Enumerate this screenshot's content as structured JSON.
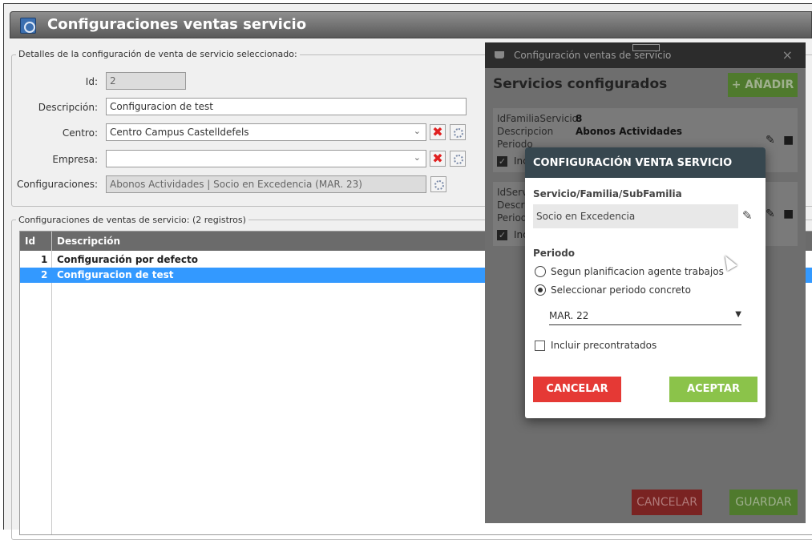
{
  "window": {
    "title": "Configuraciones ventas servicio"
  },
  "details": {
    "legend": "Detalles de la configuración de venta de servicio seleccionado:",
    "id_label": "Id:",
    "id_value": "2",
    "descripcion_label": "Descripción:",
    "descripcion_value": "Configuracion de test",
    "centro_label": "Centro:",
    "centro_value": "Centro Campus Castelldefels",
    "empresa_label": "Empresa:",
    "empresa_value": "",
    "configuraciones_label": "Configuraciones:",
    "configuraciones_value": "Abonos Actividades | Socio en Excedencia (MAR. 23)",
    "clear_glyph": "✖"
  },
  "list": {
    "legend": "Configuraciones de ventas de servicio: (2 registros)",
    "columns": [
      "Id",
      "Descripción"
    ],
    "rows": [
      {
        "id": "1",
        "descripcion": "Configuración por defecto",
        "selected": false
      },
      {
        "id": "2",
        "descripcion": "Configuracion de test",
        "selected": true
      }
    ]
  },
  "panel": {
    "title": "Configuración ventas de servicio",
    "close": "×",
    "heading": "Servicios configurados",
    "add_label": "+ AÑADIR",
    "card1": {
      "k1": "IdFamiliaServicio",
      "v1": "8",
      "k2": "Descripcion",
      "v2": "Abonos Actividades",
      "k3": "Periodo",
      "include": "Inc"
    },
    "card2": {
      "k1": "IdServi",
      "k2": "Descrip",
      "k3": "Period",
      "include": "Inc"
    },
    "cancel_label": "CANCELAR",
    "save_label": "GUARDAR"
  },
  "dialog": {
    "title": "CONFIGURACIÓN VENTA SERVICIO",
    "service_section": "Servicio/Familia/SubFamilia",
    "service_value": "Socio en Excedencia",
    "periodo_section": "Periodo",
    "option1": "Segun planificacion agente trabajos",
    "option2": "Seleccionar periodo concreto",
    "selected_option": 2,
    "period_value": "MAR. 22",
    "include_label": "Incluir precontratados",
    "include_checked": false,
    "cancel_label": "CANCELAR",
    "accept_label": "ACEPTAR"
  },
  "colors": {
    "selection": "#3399ff",
    "danger": "#e53935",
    "success": "#8bc34a",
    "dialog_header": "#37474f"
  }
}
